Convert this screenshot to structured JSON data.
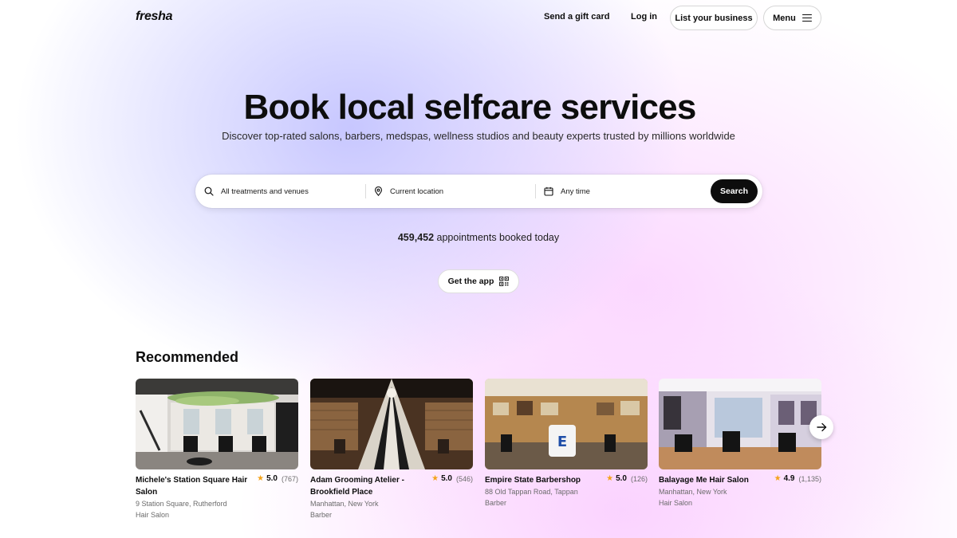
{
  "header": {
    "logo": "fresha",
    "gift_card": "Send a gift card",
    "login": "Log in",
    "list_business": "List your business",
    "menu": "Menu"
  },
  "hero": {
    "title": "Book local selfcare services",
    "subtitle": "Discover top-rated salons, barbers, medspas, wellness studios and beauty experts trusted by millions worldwide"
  },
  "search": {
    "treatments": "All treatments and venues",
    "location": "Current location",
    "time": "Any time",
    "button": "Search"
  },
  "stats": {
    "count": "459,452",
    "label": "appointments booked today"
  },
  "get_app": "Get the app",
  "recommended": {
    "title": "Recommended",
    "venues": [
      {
        "name": "Michele's Station Square Hair Salon",
        "rating": "5.0",
        "reviews": "(767)",
        "address": "9 Station Square, Rutherford",
        "category": "Hair Salon"
      },
      {
        "name": "Adam Grooming Atelier - Brookfield Place",
        "rating": "5.0",
        "reviews": "(546)",
        "address": "Manhattan, New York",
        "category": "Barber"
      },
      {
        "name": "Empire State Barbershop",
        "rating": "5.0",
        "reviews": "(126)",
        "address": "88 Old Tappan Road, Tappan",
        "category": "Barber"
      },
      {
        "name": "Balayage Me Hair Salon",
        "rating": "4.9",
        "reviews": "(1,135)",
        "address": "Manhattan, New York",
        "category": "Hair Salon"
      }
    ]
  },
  "colors": {
    "primary": "#0d0d0d",
    "star": "#f4a31a",
    "muted": "#6b6b6b",
    "hero_lavender": "#c4c4ff",
    "hero_pink": "#fbd6ff"
  },
  "icons": {
    "search": "search-icon",
    "location": "map-pin-icon",
    "calendar": "calendar-icon",
    "qr": "qr-code-icon",
    "menu": "hamburger-icon",
    "next": "arrow-right-icon",
    "star": "star-icon"
  }
}
